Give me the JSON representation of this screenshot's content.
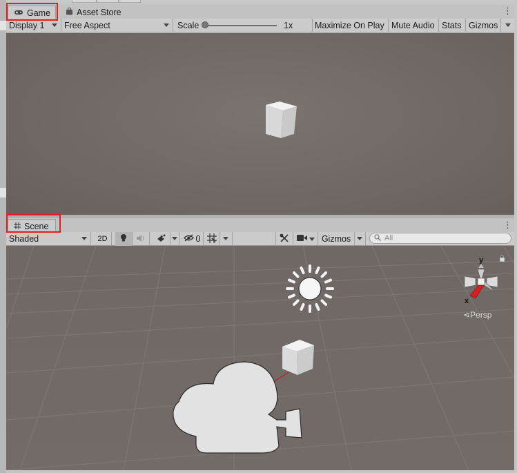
{
  "game_panel": {
    "tabs": [
      {
        "label": "Game",
        "icon": "gamepad-icon",
        "active": true
      },
      {
        "label": "Asset Store",
        "icon": "shopping-bag-icon",
        "active": false
      }
    ],
    "toolbar": {
      "display": "Display 1",
      "aspect": "Free Aspect",
      "scale_label": "Scale",
      "scale_value": "1x",
      "scale_level": 0.0,
      "maximize_on_play": "Maximize On Play",
      "mute_audio": "Mute Audio",
      "stats": "Stats",
      "gizmos": "Gizmos"
    }
  },
  "scene_panel": {
    "tab": {
      "label": "Scene",
      "icon": "grid-hash-icon",
      "active": true
    },
    "toolbar": {
      "draw_mode": "Shaded",
      "mode_2d": "2D",
      "lighting_icon": "lightbulb-icon",
      "audio_icon": "speaker-icon",
      "effects_icon": "effects-icon",
      "hidden_icon": "eye-slash-icon",
      "hidden_count": "0",
      "grid_icon": "grid-snap-icon",
      "tools_icon": "wrench-tools-icon",
      "camera_icon": "video-camera-icon",
      "gizmos": "Gizmos",
      "search_icon": "search-icon",
      "search_placeholder": "All"
    },
    "orientation_gizmo": {
      "y_label": "y",
      "x_label": "x",
      "projection": "Persp",
      "lock_icon": "lock-icon"
    },
    "scene_icons": [
      "sun-light-icon",
      "camera-gizmo-icon",
      "cube-object"
    ]
  },
  "colors": {
    "highlight_box": "#e01e1e",
    "viewport_bg": "#726a66",
    "toolbar_bg": "#cbcbcb",
    "x_axis": "#d42020"
  }
}
